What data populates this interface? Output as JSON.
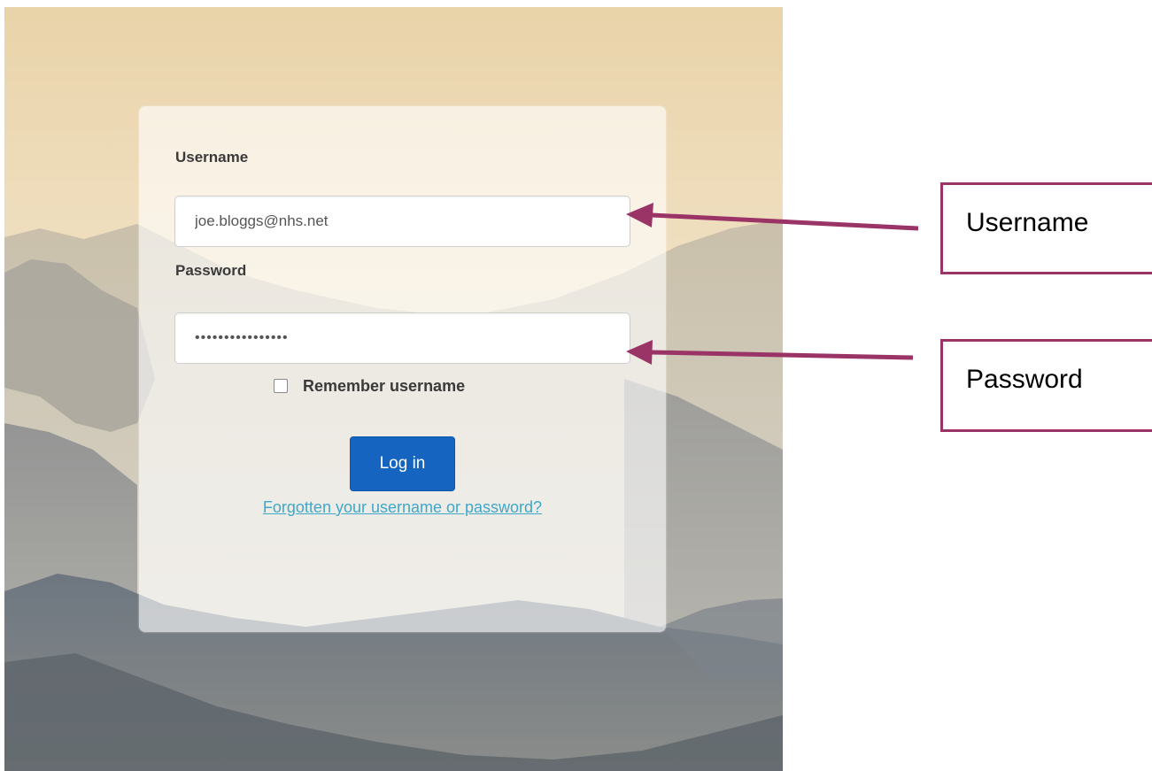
{
  "login_form": {
    "username_label": "Username",
    "username_value": "joe.bloggs@nhs.net",
    "password_label": "Password",
    "password_value": "••••••••••••••••",
    "remember_label": "Remember username",
    "remember_checked": false,
    "login_button_label": "Log in",
    "forgot_link_text": "Forgotten your username or password?"
  },
  "annotations": {
    "username_callout": "Username",
    "password_callout": "Password"
  },
  "colors": {
    "button_blue": "#1565c0",
    "link_blue": "#3fa7c9",
    "callout_border": "#9b3466",
    "arrow": "#9b3466"
  }
}
